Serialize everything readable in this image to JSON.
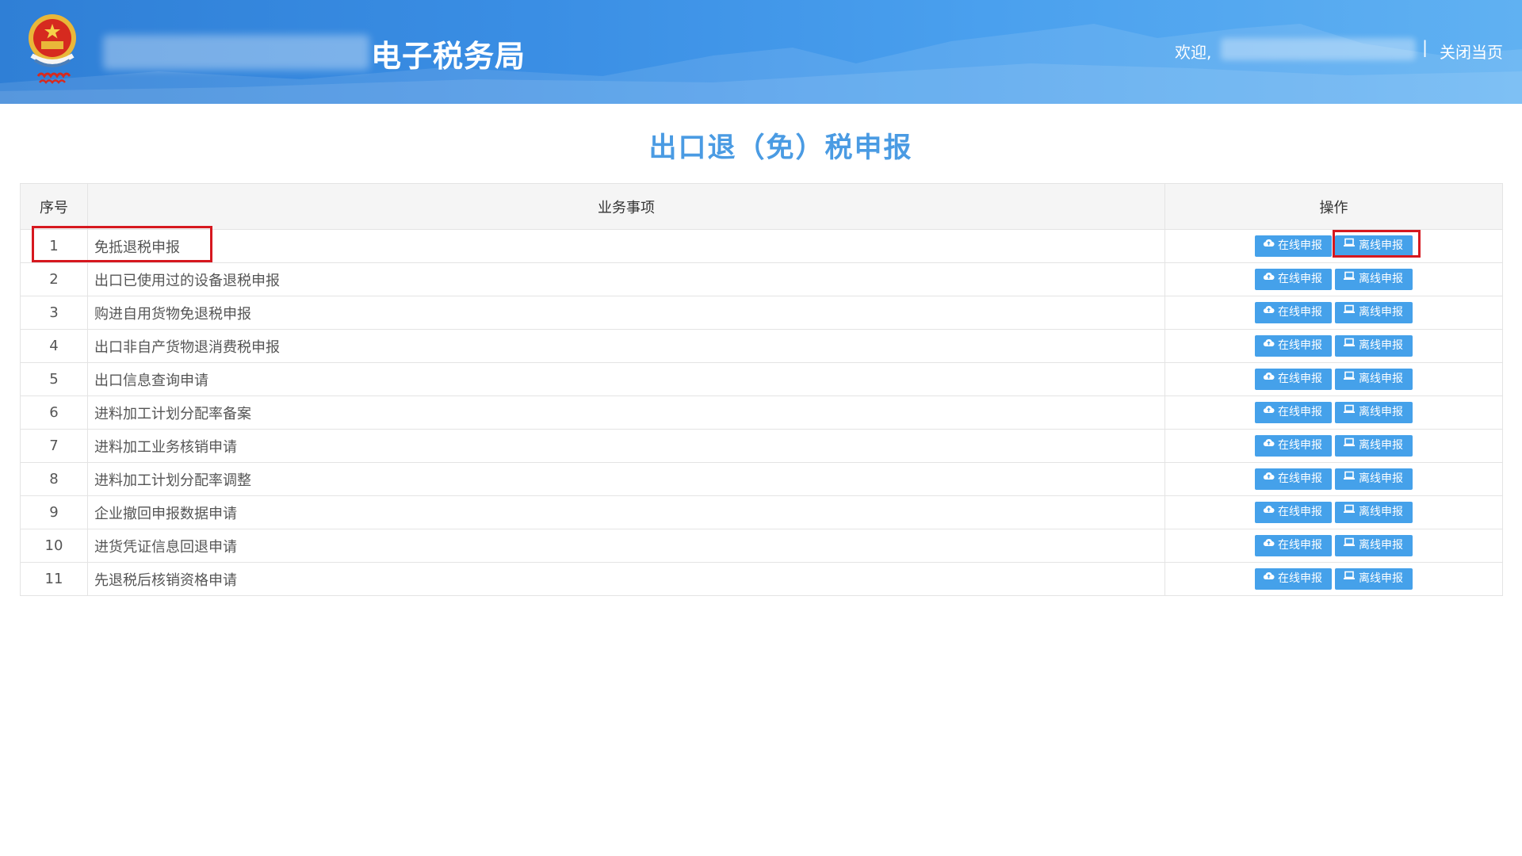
{
  "header": {
    "site_title": "电子税务局",
    "welcome_label": "欢迎,",
    "separator": "|",
    "close_label": "关闭当页",
    "emblem_text": "中国税务"
  },
  "page": {
    "title": "出口退（免）税申报"
  },
  "table": {
    "headers": [
      "序号",
      "业务事项",
      "操作"
    ],
    "online_label": "在线申报",
    "offline_label": "离线申报",
    "rows": [
      {
        "num": "1",
        "name": "免抵退税申报"
      },
      {
        "num": "2",
        "name": "出口已使用过的设备退税申报"
      },
      {
        "num": "3",
        "name": "购进自用货物免退税申报"
      },
      {
        "num": "4",
        "name": "出口非自产货物退消费税申报"
      },
      {
        "num": "5",
        "name": "出口信息查询申请"
      },
      {
        "num": "6",
        "name": "进料加工计划分配率备案"
      },
      {
        "num": "7",
        "name": "进料加工业务核销申请"
      },
      {
        "num": "8",
        "name": "进料加工计划分配率调整"
      },
      {
        "num": "9",
        "name": "企业撤回申报数据申请"
      },
      {
        "num": "10",
        "name": "进货凭证信息回退申请"
      },
      {
        "num": "11",
        "name": "先退税后核销资格申请"
      }
    ]
  },
  "colors": {
    "header_start": "#2f7fd6",
    "header_end": "#60b1f2",
    "title": "#4a9be3",
    "button": "#45a1ea",
    "highlight": "#d6181f"
  }
}
